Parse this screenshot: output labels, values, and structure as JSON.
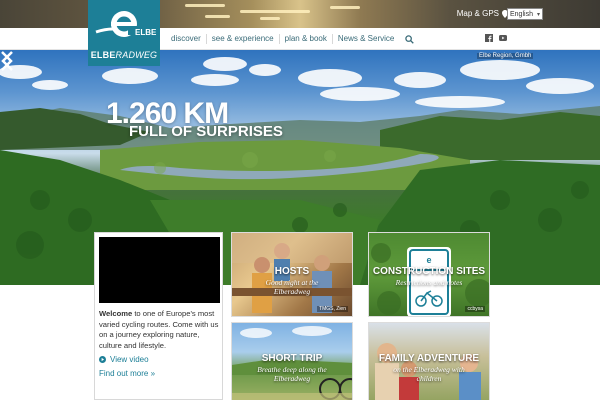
{
  "header": {
    "map_gps": "Map & GPS",
    "language": "English",
    "nav": [
      "discover",
      "see & experience",
      "plan & book",
      "News & Service"
    ]
  },
  "logo": {
    "mark_letters": "ELBE",
    "name_part1": "ELBE",
    "name_part2": "RADWEG"
  },
  "hero": {
    "title": "1.260 KM",
    "subtitle": "FULL OF SURPRISES",
    "credit": "Elbe Region, Gmbh"
  },
  "intro": {
    "welcome_bold": "Welcome",
    "welcome_text": " to one of Europe's most varied cycling routes. Come with us on a journey exploring nature, culture and lifestyle.",
    "view_video": "View video",
    "find_out_more": "Find out more »"
  },
  "tiles": [
    {
      "title": "HOSTS",
      "subtitle": "Good night at the Elberadweg",
      "credit": "TMGS, Zien"
    },
    {
      "title": "CONSTRUCTION SITES",
      "subtitle": "Restrictions and notes",
      "credit": "ccbysa"
    },
    {
      "title": "SHORT TRIP",
      "subtitle": "Breathe deep along the Elberadweg",
      "credit": ""
    },
    {
      "title": "FAMILY ADVENTURE",
      "subtitle": "on the Elberadweg with children",
      "credit": ""
    }
  ],
  "colors": {
    "brand_teal": "#1d7f97",
    "nav_text": "#3a6b78"
  },
  "icons": [
    "pin-icon",
    "search-icon",
    "facebook-icon",
    "youtube-icon",
    "arrow-left-icon",
    "arrow-right-icon",
    "play-icon"
  ]
}
